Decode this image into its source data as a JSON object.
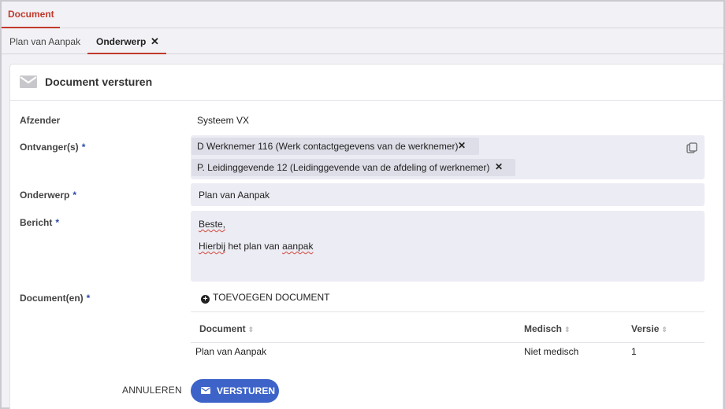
{
  "top_tab": "Document",
  "sub_tabs": [
    "Plan van Aanpak",
    "Onderwerp"
  ],
  "card": {
    "title": "Document versturen"
  },
  "form": {
    "sender_label": "Afzender",
    "sender_value": "Systeem VX",
    "recipients_label": "Ontvanger(s)",
    "recipients": [
      "D Werknemer 116 (Werk contactgegevens van de werknemer)",
      "P. Leidinggevende 12 (Leidinggevende van de afdeling of werknemer)"
    ],
    "subject_label": "Onderwerp",
    "subject_value": "Plan van Aanpak",
    "message_label": "Bericht",
    "message_line1": "Beste,",
    "message_line2_word1": "Hierbij",
    "message_line2_mid": " het plan van ",
    "message_line2_word2": "aanpak",
    "documents_label": "Document(en)",
    "required_marker": "*"
  },
  "documents": {
    "add_label": "TOEVOEGEN DOCUMENT",
    "columns": [
      "Document",
      "Medisch",
      "Versie"
    ],
    "rows": [
      {
        "document": "Plan van Aanpak",
        "medisch": "Niet medisch",
        "versie": "1"
      }
    ]
  },
  "actions": {
    "cancel": "ANNULEREN",
    "send": "VERSTUREN"
  },
  "colors": {
    "accent": "#c0392b",
    "primary": "#3d63c9",
    "field_bg": "#ececf4"
  }
}
